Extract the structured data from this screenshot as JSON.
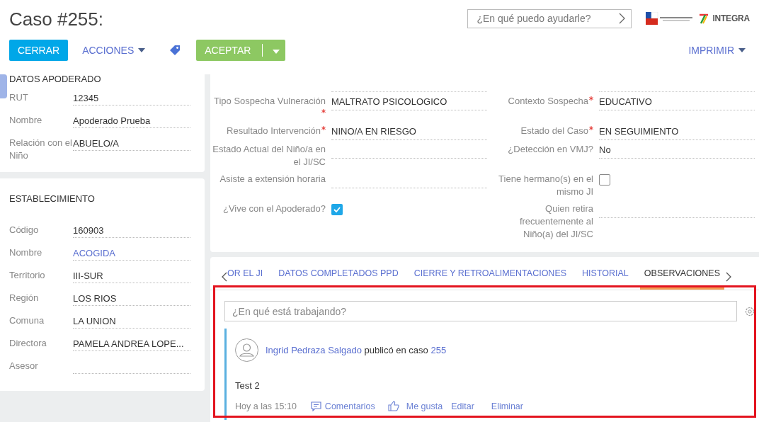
{
  "header": {
    "title": "Caso #255:",
    "search": {
      "placeholder": "¿En qué puedo ayudarle?"
    },
    "logo_text": "INTEGRA"
  },
  "toolbar": {
    "buttons": [
      {
        "kind": "primary",
        "label": "CERRAR"
      },
      {
        "kind": "menu",
        "label": "ACCIONES"
      },
      {
        "kind": "tag"
      },
      {
        "kind": "split",
        "label": "ACEPTAR"
      }
    ],
    "print_menu": {
      "label": "IMPRIMIR"
    }
  },
  "sidebar": {
    "cards": [
      {
        "title": "DATOS APODERADO",
        "fields": [
          {
            "label": "RUT",
            "value": "12345",
            "kind": "text"
          },
          {
            "label": "Nombre",
            "value": "Apoderado Prueba",
            "kind": "text"
          },
          {
            "label": "Relación con el Niño",
            "value": "ABUELO/A",
            "kind": "text"
          }
        ]
      },
      {
        "title": "ESTABLECIMIENTO",
        "fields": [
          {
            "label": "Código",
            "value": "160903",
            "kind": "text"
          },
          {
            "label": "Nombre",
            "value": "ACOGIDA",
            "kind": "link"
          },
          {
            "label": "Territorio",
            "value": "III-SUR",
            "kind": "text"
          },
          {
            "label": "Región",
            "value": "LOS RIOS",
            "kind": "text"
          },
          {
            "label": "Comuna",
            "value": "LA UNION",
            "kind": "text"
          },
          {
            "label": "Directora",
            "value": "PAMELA ANDREA LOPE...",
            "kind": "text"
          },
          {
            "label": "Asesor",
            "kind": "text"
          }
        ]
      }
    ]
  },
  "form": {
    "rows": [
      {
        "left": {
          "kind": "text",
          "label": "Tipo Sospecha Vulneración",
          "required": true,
          "value": "MALTRATO PSICOLOGICO"
        },
        "right": {
          "kind": "text",
          "label": "Contexto Sospecha",
          "required": true,
          "value": "EDUCATIVO"
        }
      },
      {
        "left": {
          "kind": "text",
          "label": "Resultado Intervención",
          "required": true,
          "value": "NINO/A EN RIESGO"
        },
        "right": {
          "kind": "text",
          "label": "Estado del Caso",
          "required": true,
          "value": "EN SEGUIMIENTO"
        }
      },
      {
        "left": {
          "kind": "text",
          "label": "Estado Actual del Niño/a en el JI/SC",
          "required": false
        },
        "right": {
          "kind": "text",
          "label": "¿Detección en VMJ?",
          "required": false,
          "value": "No"
        }
      },
      {
        "left": {
          "kind": "text",
          "label": "Asiste a extensión horaria",
          "required": false
        },
        "right": {
          "kind": "checkbox",
          "label": "Tiene hermano(s) en el mismo JI",
          "required": false,
          "checked": false
        }
      },
      {
        "left": {
          "kind": "checkbox",
          "label": "¿Vive con el Apoderado?",
          "required": false,
          "checked": true
        },
        "right": {
          "kind": "text",
          "label": "Quien retira frecuentemente al Niño(a) del JI/SC",
          "required": false
        }
      }
    ]
  },
  "feed": {
    "tabs": [
      {
        "label": "OR EL JI",
        "selected": false
      },
      {
        "label": "DATOS COMPLETADOS PPD",
        "selected": false
      },
      {
        "label": "CIERRE Y RETROALIMENTACIONES",
        "selected": false
      },
      {
        "label": "HISTORIAL",
        "selected": false
      },
      {
        "label": "OBSERVACIONES",
        "selected": true
      }
    ],
    "composer": {
      "placeholder": "¿En qué está trabajando?"
    },
    "posts": [
      {
        "author": "Ingrid Pedraza Salgado",
        "action": "publicó en caso",
        "case_link": "255",
        "body": "Test 2",
        "time": "Hoy a las 15:10",
        "comments_label": "Comentarios",
        "like_label": "Me gusta",
        "edit_label": "Editar",
        "delete_label": "Eliminar"
      }
    ]
  }
}
